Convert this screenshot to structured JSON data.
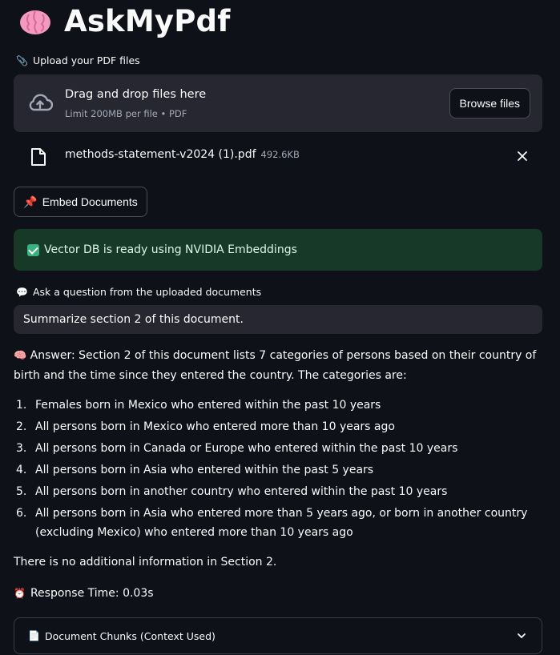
{
  "app": {
    "title": "AskMyPdf",
    "title_icon": "brain-icon"
  },
  "uploader": {
    "label_icon": "paperclip-icon",
    "label": "Upload your PDF files",
    "drop_title": "Drag and drop files here",
    "drop_subtitle": "Limit 200MB per file • PDF",
    "browse_label": "Browse files",
    "file": {
      "name": "methods-statement-v2024 (1).pdf",
      "size": "492.6KB"
    }
  },
  "embed": {
    "button_icon": "pushpin-icon",
    "button_label": "Embed Documents"
  },
  "status": {
    "message": "Vector DB is ready using NVIDIA Embeddings",
    "color": "#173928"
  },
  "question": {
    "label_icon": "speech-bubble-icon",
    "label": "Ask a question from the uploaded documents",
    "value": "Summarize section 2 of this document."
  },
  "answer": {
    "intro": "Answer: Section 2 of this document lists 7 categories of persons based on their country of birth and the time since they entered the country. The categories are:",
    "items": [
      "Females born in Mexico who entered within the past 10 years",
      "All persons born in Mexico who entered more than 10 years ago",
      "All persons born in Canada or Europe who entered within the past 10 years",
      "All persons born in Asia who entered within the past 5 years",
      "All persons born in another country who entered within the past 10 years",
      "All persons born in Asia who entered more than 5 years ago, or born in another country (excluding Mexico) who entered more than 10 years ago"
    ],
    "closing": "There is no additional information in Section 2."
  },
  "response_time": {
    "icon": "alarm-clock-icon",
    "text": "Response Time: 0.03s"
  },
  "chunks_expander": {
    "icon": "page-icon",
    "label": "Document Chunks (Context Used)"
  },
  "colors": {
    "background": "#0e1117",
    "surface": "#262730",
    "success": "#173928"
  }
}
